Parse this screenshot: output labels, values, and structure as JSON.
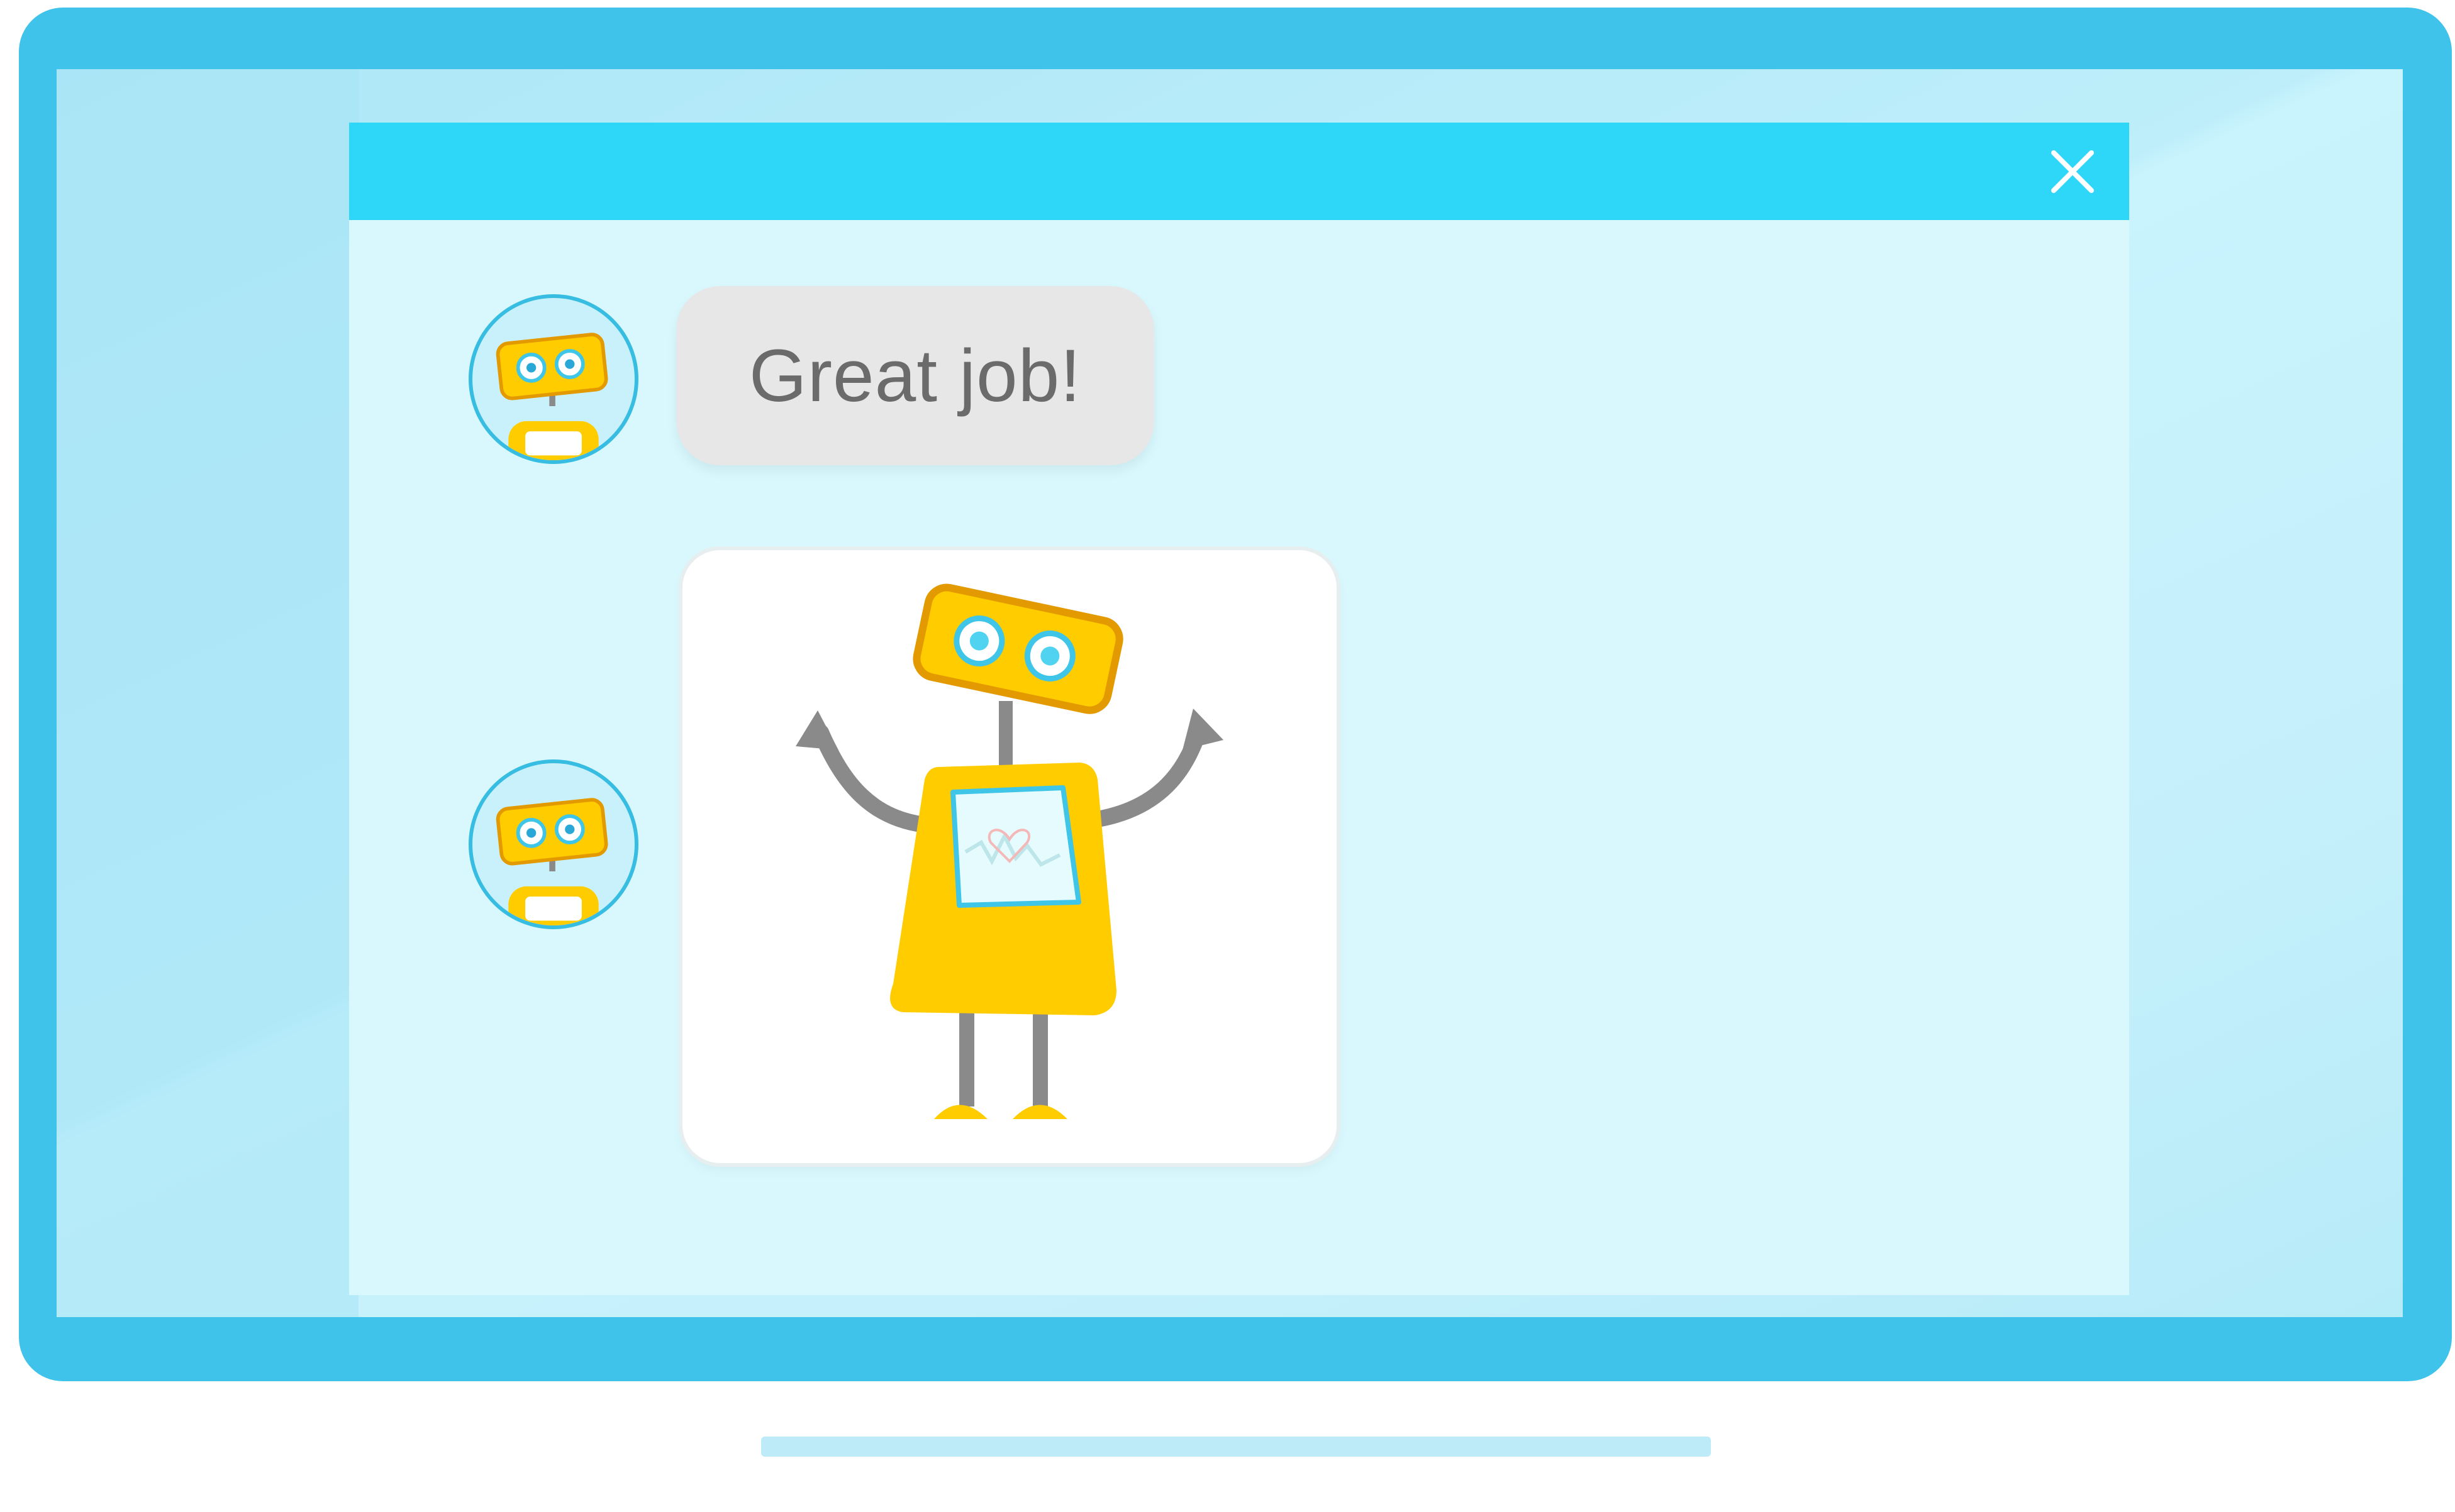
{
  "chat": {
    "close_icon": "close-icon",
    "messages": [
      {
        "sender": "robot",
        "type": "text",
        "text": "Great job!"
      },
      {
        "sender": "robot",
        "type": "image",
        "image": "robot-illustration"
      }
    ]
  },
  "colors": {
    "bezel": "#3fc3ea",
    "titlebar": "#2ed6f8",
    "chat_background": "#d8f8fd",
    "bubble": "#e7e7e7",
    "bubble_text": "#6b6b6b",
    "robot_yellow": "#ffcc00",
    "robot_gray": "#8a8a8a"
  }
}
